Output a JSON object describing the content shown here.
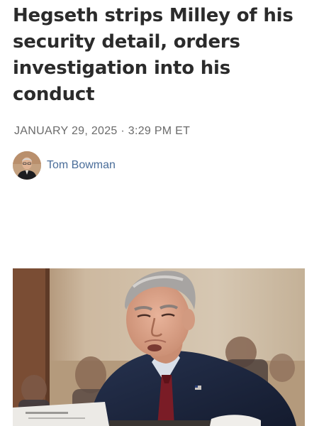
{
  "article": {
    "headline": "Hegseth strips Milley of his security detail, orders investigation into his conduct",
    "dateline": "JANUARY 29, 2025 · 3:29 PM ET",
    "author": {
      "name": "Tom Bowman",
      "avatar_icon": "author-avatar"
    },
    "photo": {
      "subject_icon": "photo-of-man-in-military-uniform-at-hearing"
    }
  },
  "colors": {
    "headline": "#2b2b2b",
    "dateline": "#6b6b6b",
    "author_link": "#4a6d99",
    "uniform": "#1f2a44"
  }
}
